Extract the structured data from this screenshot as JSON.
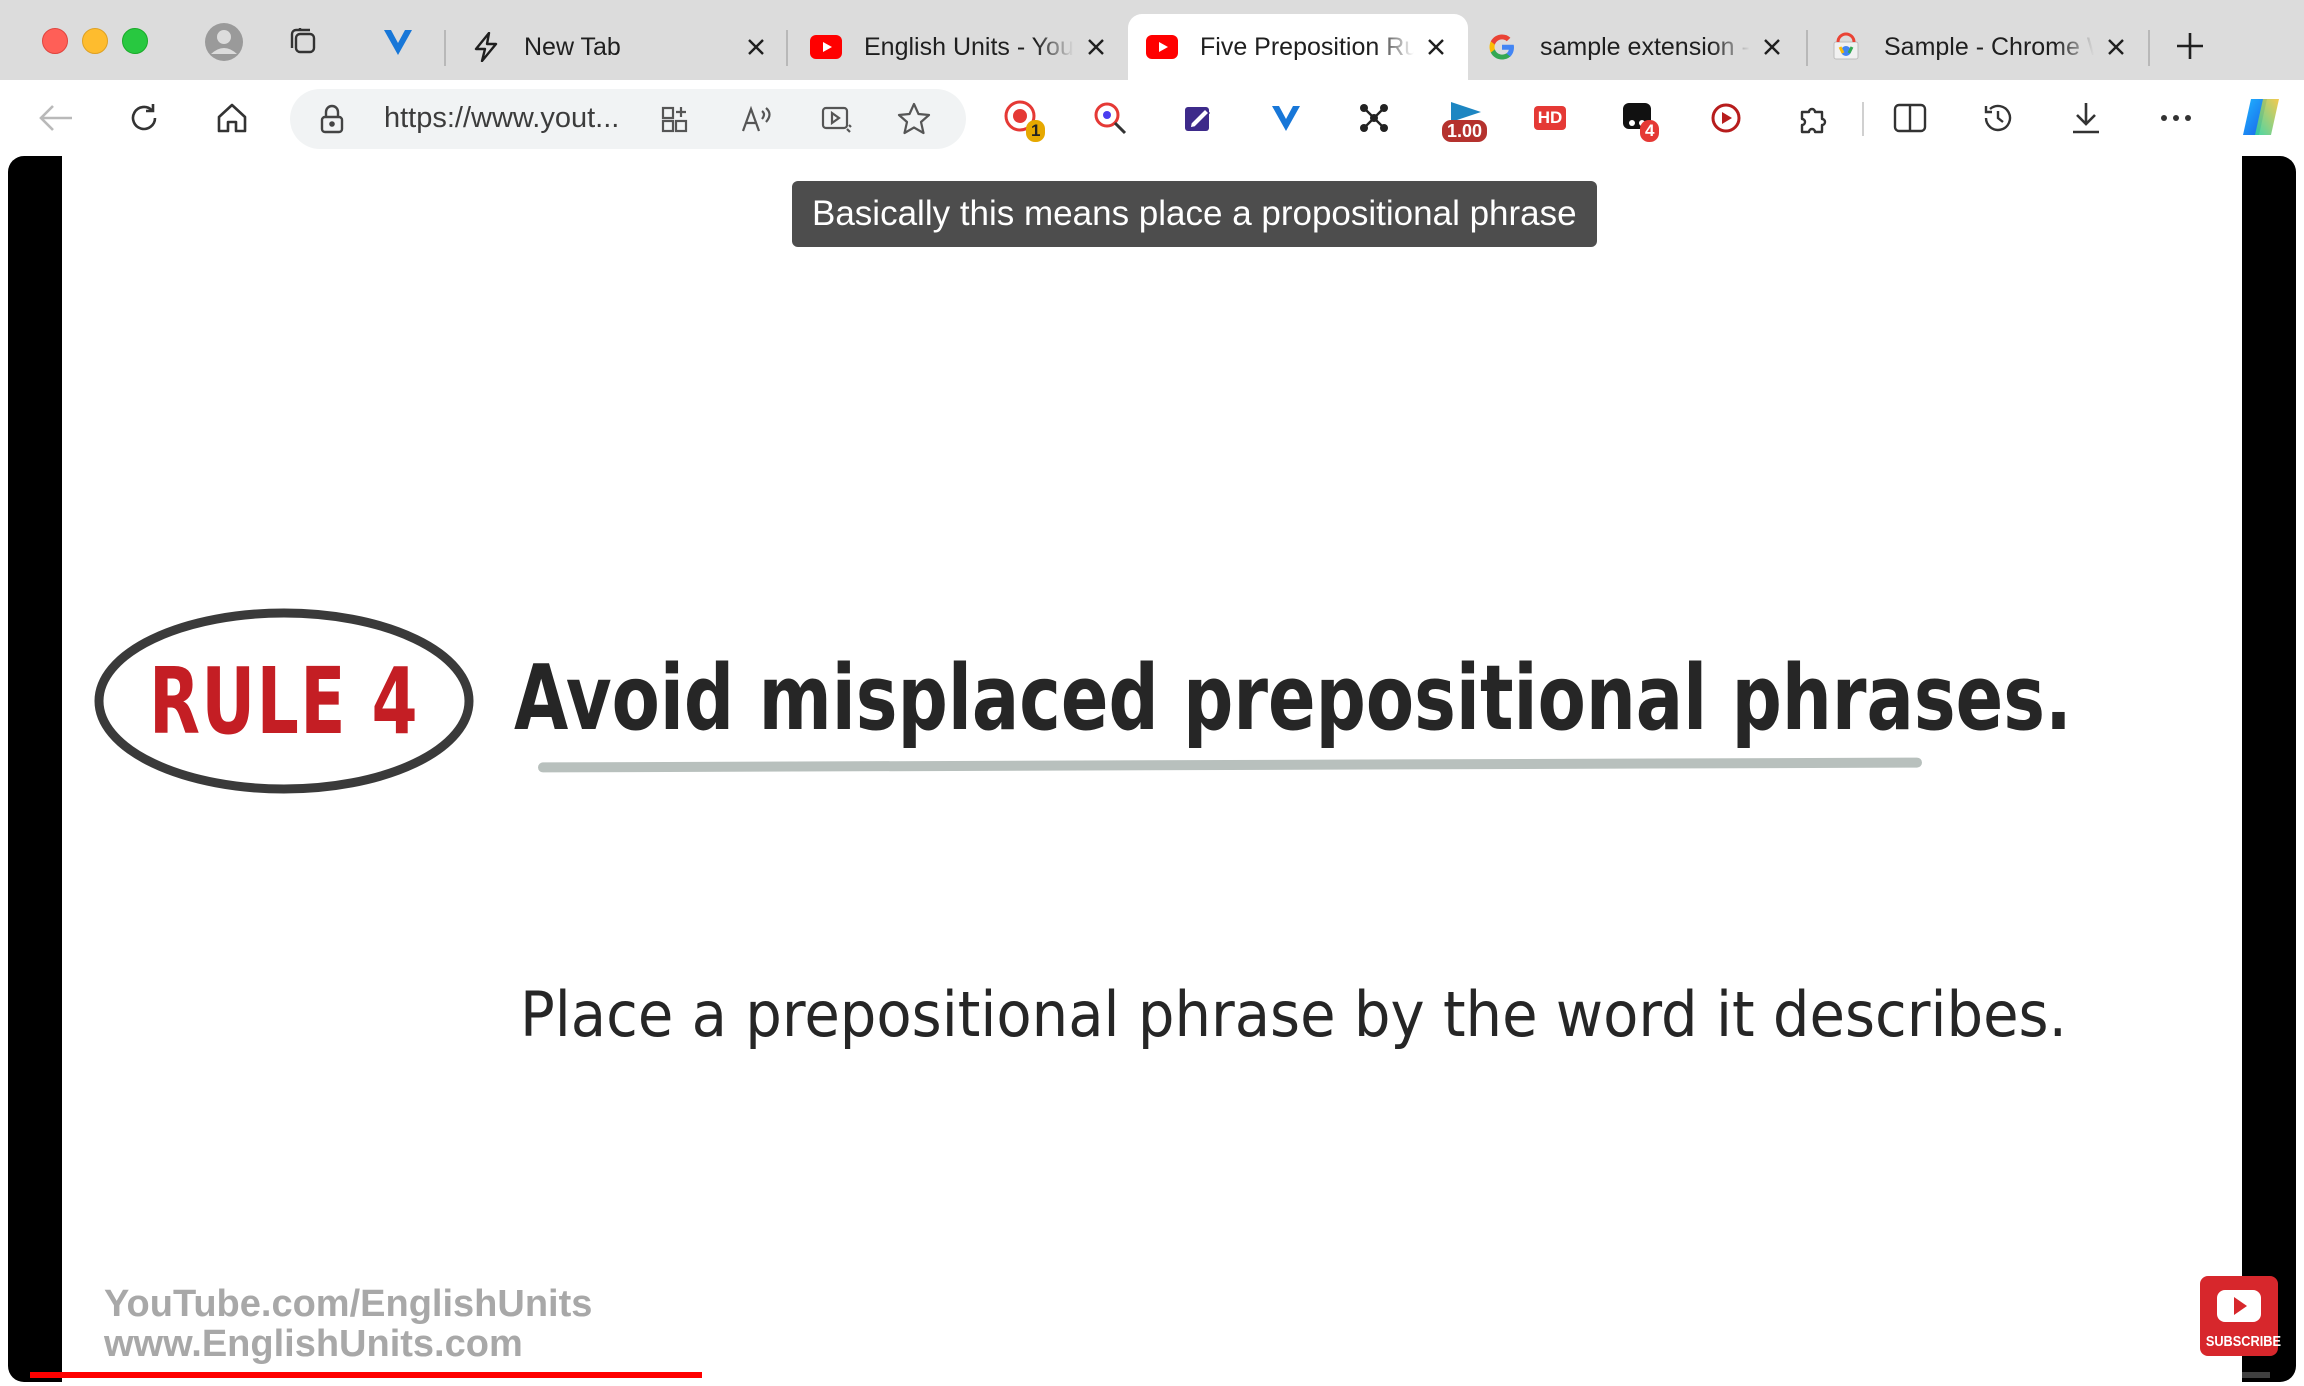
{
  "window": {
    "tabs": [
      {
        "title": "New Tab",
        "favicon": "bolt-icon",
        "active": false
      },
      {
        "title": "English Units - YouTube",
        "favicon": "youtube-icon",
        "active": false
      },
      {
        "title": "Five Preposition Rules",
        "favicon": "youtube-icon",
        "active": true
      },
      {
        "title": "sample extension - Google Search",
        "favicon": "google-icon",
        "active": false
      },
      {
        "title": "Sample - Chrome Web Store",
        "favicon": "chrome-webstore-icon",
        "active": false
      }
    ]
  },
  "toolbar": {
    "url": "https://www.yout...",
    "extension_badges": {
      "screen_recorder": "1",
      "speed": "1.00",
      "hd": "HD",
      "notifications": "4"
    }
  },
  "video": {
    "caption": "Basically this means place a propositional phrase",
    "rule_label": "RULE 4",
    "headline": "Avoid misplaced prepositional phrases.",
    "subtitle": "Place a prepositional phrase by the word it describes.",
    "watermark_line1": "YouTube.com/EnglishUnits",
    "watermark_line2": "www.EnglishUnits.com",
    "subscribe_label": "SUBSCRIBE",
    "progress": 0.3
  },
  "colors": {
    "rule_red": "#c41e24",
    "progress_red": "#ff0000",
    "youtube_red": "#ff0000"
  }
}
